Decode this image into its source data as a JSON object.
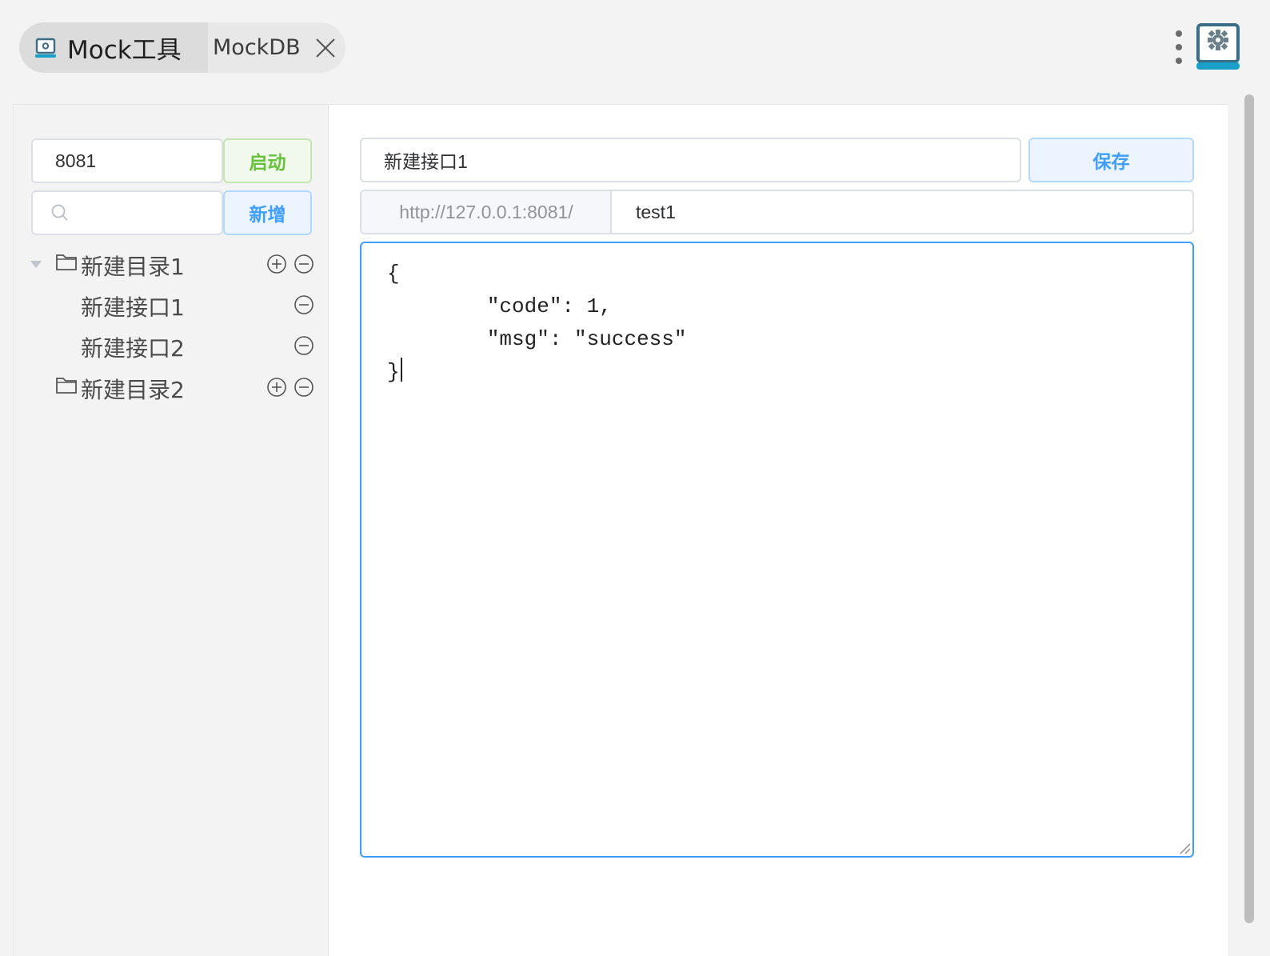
{
  "tabs": [
    {
      "label": "Mock工具",
      "active": true,
      "icon": "app-monitor-icon"
    },
    {
      "label": "MockDB",
      "active": false,
      "icon": "close-icon"
    }
  ],
  "toolbar": {
    "more_icon": "more-vertical-icon",
    "logo_icon": "settings-monitor-icon"
  },
  "sidebar": {
    "port": {
      "value": "8081"
    },
    "start_label": "启动",
    "search": {
      "value": "",
      "placeholder": ""
    },
    "add_label": "新增",
    "tree": [
      {
        "type": "folder",
        "label": "新建目录1",
        "expanded": true,
        "children": [
          {
            "type": "api",
            "label": "新建接口1"
          },
          {
            "type": "api",
            "label": "新建接口2"
          }
        ]
      },
      {
        "type": "folder",
        "label": "新建目录2",
        "expanded": false,
        "children": []
      }
    ]
  },
  "editor": {
    "name": {
      "value": "新建接口1"
    },
    "save_label": "保存",
    "url_prefix": "http://127.0.0.1:8081/",
    "path": {
      "value": "test1"
    },
    "body": "{\n        \"code\": 1,\n        \"msg\": \"success\"\n}"
  },
  "colors": {
    "primary": "#409eff",
    "success": "#67c23a",
    "logo": "#1aa0c8"
  }
}
